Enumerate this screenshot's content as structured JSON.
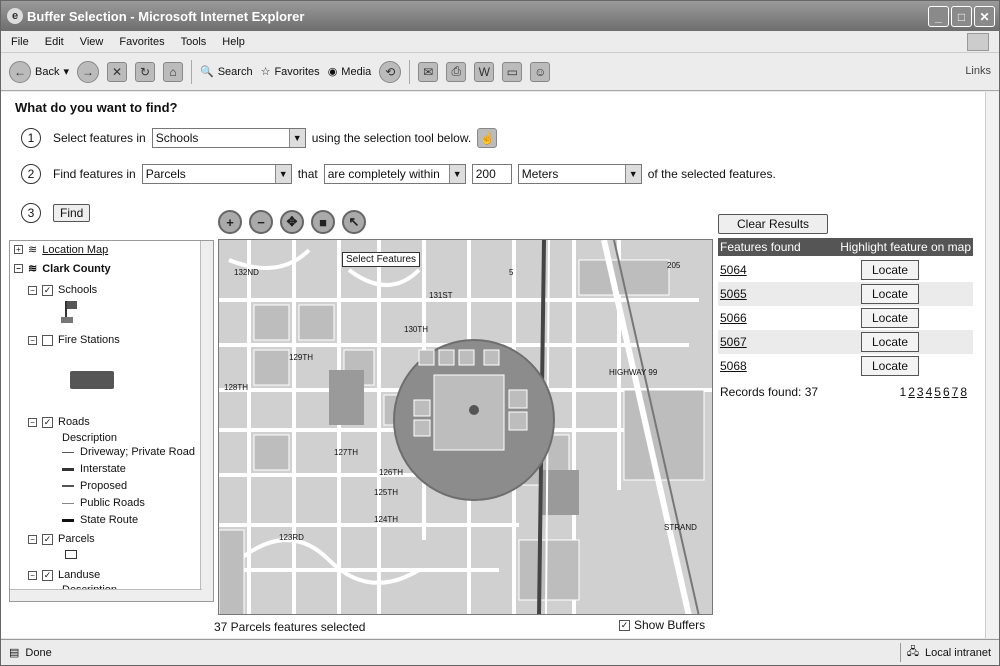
{
  "window": {
    "title": "Buffer Selection - Microsoft Internet Explorer",
    "menu": [
      "File",
      "Edit",
      "View",
      "Favorites",
      "Tools",
      "Help"
    ],
    "toolbar": {
      "back": "Back",
      "search": "Search",
      "favorites": "Favorites",
      "media": "Media",
      "links": "Links"
    },
    "status": {
      "text": "Done",
      "zone": "Local intranet"
    }
  },
  "page": {
    "heading": "What do you want to find?",
    "step1": {
      "num": "1",
      "prefix": "Select features in",
      "layer": "Schools",
      "suffix": "using the selection tool below."
    },
    "step2": {
      "num": "2",
      "prefix": "Find features in",
      "layer": "Parcels",
      "that": "that",
      "relation": "are completely within",
      "distance": "200",
      "units": "Meters",
      "suffix": "of the selected features."
    },
    "step3": {
      "num": "3",
      "find_label": "Find"
    },
    "clear_results": "Clear Results"
  },
  "toc": {
    "location_map": "Location Map",
    "county": "Clark County",
    "layers": {
      "schools": "Schools",
      "fire_stations": "Fire Stations",
      "roads": "Roads",
      "roads_description": "Description",
      "road_types": [
        "Driveway; Private Road",
        "Interstate",
        "Proposed",
        "Public Roads",
        "State Route"
      ],
      "parcels": "Parcels",
      "landuse": "Landuse",
      "landuse_description": "Description"
    }
  },
  "map": {
    "tooltip": "Select Features",
    "selected_count_text": "37 Parcels features selected",
    "show_buffers": "Show Buffers",
    "labels": [
      "132ND",
      "131ST",
      "130TH",
      "129TH",
      "128TH",
      "127TH",
      "126TH",
      "125TH",
      "124TH",
      "123RD",
      "HIGHWAY 99",
      "STRAND",
      "5",
      "205"
    ]
  },
  "results": {
    "header_left": "Features found",
    "header_right": "Highlight feature on map",
    "rows": [
      {
        "id": "5064",
        "button": "Locate"
      },
      {
        "id": "5065",
        "button": "Locate"
      },
      {
        "id": "5066",
        "button": "Locate"
      },
      {
        "id": "5067",
        "button": "Locate"
      },
      {
        "id": "5068",
        "button": "Locate"
      }
    ],
    "records_found": "Records found: 37",
    "pages": [
      "1",
      "2",
      "3",
      "4",
      "5",
      "6",
      "7",
      "8"
    ]
  },
  "colors": {
    "title_bar": "#7a7a7a",
    "results_header": "#555555",
    "buffer": "#8c8c8c"
  }
}
